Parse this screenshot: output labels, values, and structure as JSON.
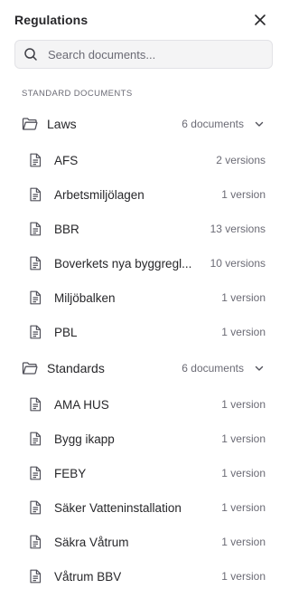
{
  "header": {
    "title": "Regulations"
  },
  "search": {
    "placeholder": "Search documents..."
  },
  "section": {
    "label": "STANDARD DOCUMENTS"
  },
  "groups": [
    {
      "name": "Laws",
      "count": "6 documents",
      "items": [
        {
          "name": "AFS",
          "versions": "2 versions"
        },
        {
          "name": "Arbetsmiljölagen",
          "versions": "1 version"
        },
        {
          "name": "BBR",
          "versions": "13 versions"
        },
        {
          "name": "Boverkets nya byggregl...",
          "versions": "10 versions"
        },
        {
          "name": "Miljöbalken",
          "versions": "1 version"
        },
        {
          "name": "PBL",
          "versions": "1 version"
        }
      ]
    },
    {
      "name": "Standards",
      "count": "6 documents",
      "items": [
        {
          "name": "AMA HUS",
          "versions": "1 version"
        },
        {
          "name": "Bygg ikapp",
          "versions": "1 version"
        },
        {
          "name": "FEBY",
          "versions": "1 version"
        },
        {
          "name": "Säker Vatteninstallation",
          "versions": "1 version"
        },
        {
          "name": "Säkra Våtrum",
          "versions": "1 version"
        },
        {
          "name": "Våtrum BBV",
          "versions": "1 version"
        }
      ]
    }
  ],
  "colors": {
    "text": "#27272a",
    "muted": "#6b6b75",
    "border": "#e2e2e6",
    "input_bg": "#f4f4f5"
  },
  "icons": {
    "close": "close-icon",
    "search": "search-icon",
    "folder": "folder-icon",
    "chevron": "chevron-down-icon",
    "file": "file-text-icon"
  }
}
